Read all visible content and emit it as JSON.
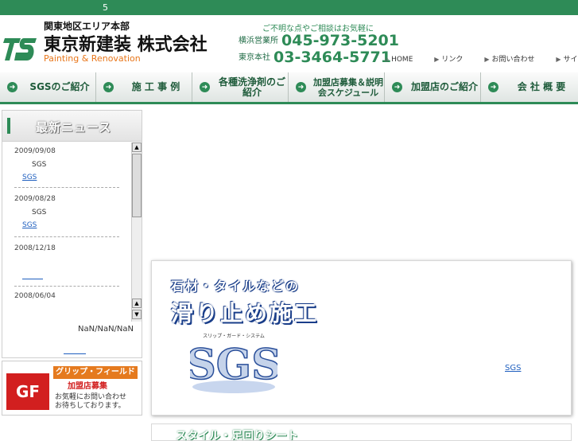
{
  "topbar": {
    "text": "5"
  },
  "header": {
    "region": "関東地区エリア本部",
    "company_name": "東京新建装 株式会社",
    "tagline": "Painting & Renovation",
    "contact_note": "ご不明な点やご相談はお気軽に",
    "offices": [
      {
        "label": "横浜営業所",
        "phone": "045-973-5201"
      },
      {
        "label": "東京本社",
        "phone": "03-3464-5771"
      }
    ],
    "util_links": [
      "HOME",
      "リンク",
      "お問い合わせ",
      "サイトマップ"
    ]
  },
  "global_nav": [
    {
      "label": "SGSのご紹介"
    },
    {
      "label": "施 工 事 例"
    },
    {
      "label": "各種洗浄剤のご紹介"
    },
    {
      "label": "加盟店募集＆説明会スケジュール"
    },
    {
      "label": "加盟店のご紹介"
    },
    {
      "label": "会 社 概 要"
    }
  ],
  "news": {
    "title": "最新ニュース",
    "entries": [
      {
        "date": "2009/09/08",
        "text": "SGS",
        "link": "SGS"
      },
      {
        "date": "2009/08/28",
        "text": "SGS",
        "link": "SGS"
      },
      {
        "date": "2008/12/18",
        "text": "",
        "link": ""
      },
      {
        "date": "2008/06/04",
        "text": "",
        "link": ""
      }
    ],
    "bottom_date": "NaN/NaN/NaN"
  },
  "banner": {
    "logo": "GF",
    "title": "グリップ・フィールド",
    "subtitle": "加盟店募集",
    "note_line1": "お気軽にお問い合わせ",
    "note_line2": "お待ちしております。"
  },
  "feature": {
    "line1": "石材・タイルなどの",
    "line2": "滑り止め施工",
    "logo_text": "SGS",
    "logo_sub": "スリップ・ガード・システム",
    "link": "SGS"
  },
  "feature2": {
    "line1": "スタイル・足回りシート"
  },
  "colors": {
    "brand_green": "#2e8b57",
    "accent_orange": "#e8761a",
    "link_blue": "#1f5fbf"
  }
}
